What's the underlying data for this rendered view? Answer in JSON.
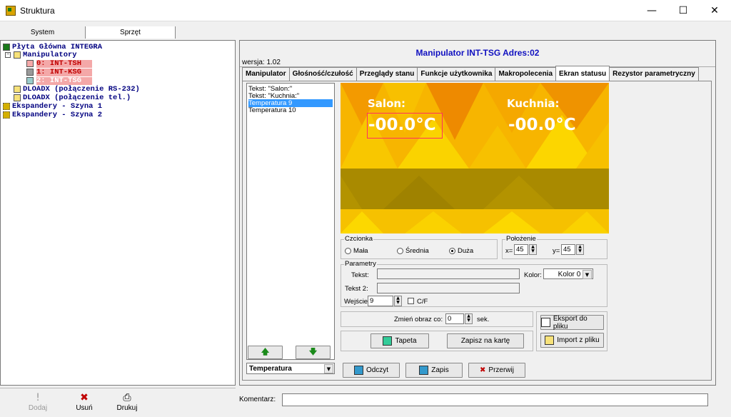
{
  "window": {
    "title": "Struktura",
    "minimize": "—",
    "maximize": "☐",
    "close": "✕"
  },
  "left_tabs": [
    "System",
    "Sprzęt"
  ],
  "tree": {
    "root": "Płyta Główna INTEGRA",
    "manipulatory": "Manipulatory",
    "items": [
      "0: INT-TSH",
      "1: INT-KSG",
      "2: INT-TSG"
    ],
    "dloadx1": "DLOADX (połączenie RS-232)",
    "dloadx2": "DLOADX (połączenie tel.)",
    "exp1": "Ekspandery - Szyna 1",
    "exp2": "Ekspandery - Szyna 2"
  },
  "tools": {
    "add": "Dodaj",
    "remove": "Usuń",
    "print": "Drukuj"
  },
  "header": {
    "title": "Manipulator INT-TSG Adres:02",
    "version": "wersja: 1.02"
  },
  "tabs": [
    "Manipulator",
    "Głośność/czułość",
    "Przeglądy stanu",
    "Funkcje użytkownika",
    "Makropolecenia",
    "Ekran statusu",
    "Rezystor parametryczny"
  ],
  "list_items": [
    "Tekst: \"Salon:\"",
    "Tekst: \"Kuchnia:\"",
    "Temperatura 9",
    "Temperatura 10"
  ],
  "list_controls": {
    "type_combo": "Temperatura",
    "add": "Dodaj",
    "remove": "Usuń"
  },
  "preview": {
    "label1": "Salon:",
    "label2": "Kuchnia:",
    "value1": "-00.0°C",
    "value2": "-00.0°C"
  },
  "font_group": {
    "title": "Czcionka",
    "small": "Mała",
    "medium": "Średnia",
    "large": "Duża",
    "selected": "Duża"
  },
  "position_group": {
    "title": "Położenie",
    "x_label": "x=",
    "x": "45",
    "y_label": "y=",
    "y": "45"
  },
  "params": {
    "title": "Parametry",
    "text_label": "Tekst:",
    "text": "",
    "text2_label": "Tekst 2:",
    "text2": "",
    "color_label": "Kolor:",
    "color": "Kolor 0",
    "input_label": "Wejście:",
    "input": "9",
    "cf_label": "C/F"
  },
  "change": {
    "label": "Zmień obraz co:",
    "value": "0",
    "unit": "sek."
  },
  "buttons": {
    "wallpaper": "Tapeta",
    "save_card": "Zapisz na kartę",
    "export": "Eksport do pliku",
    "import": "Import z pliku",
    "read": "Odczyt",
    "write": "Zapis",
    "interrupt": "Przerwij"
  },
  "comment_label": "Komentarz:"
}
